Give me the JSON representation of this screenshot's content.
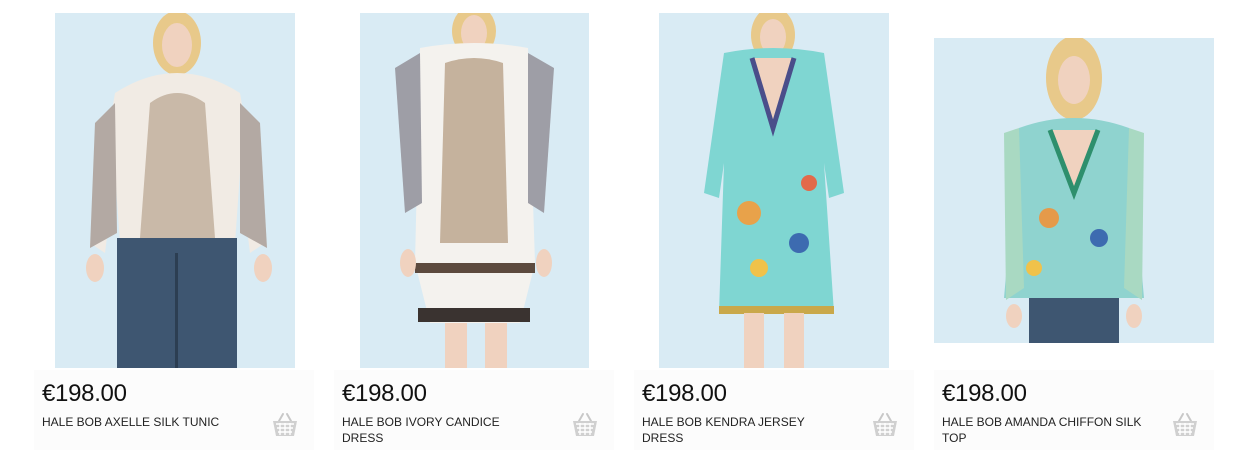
{
  "products": [
    {
      "price": "€198.00",
      "name": "HALE BOB AXELLE SILK TUNIC",
      "image_icon": "product-photo",
      "cart_icon": "basket-icon"
    },
    {
      "price": "€198.00",
      "name": "HALE BOB IVORY CANDICE DRESS",
      "image_icon": "product-photo",
      "cart_icon": "basket-icon"
    },
    {
      "price": "€198.00",
      "name": "HALE BOB KENDRA JERSEY DRESS",
      "image_icon": "product-photo",
      "cart_icon": "basket-icon"
    },
    {
      "price": "€198.00",
      "name": "HALE BOB AMANDA CHIFFON SILK TOP",
      "image_icon": "product-photo",
      "cart_icon": "basket-icon"
    }
  ],
  "colors": {
    "photo_bg": "#d7e9f3",
    "text": "#111111",
    "basket": "#c8c8c8"
  }
}
